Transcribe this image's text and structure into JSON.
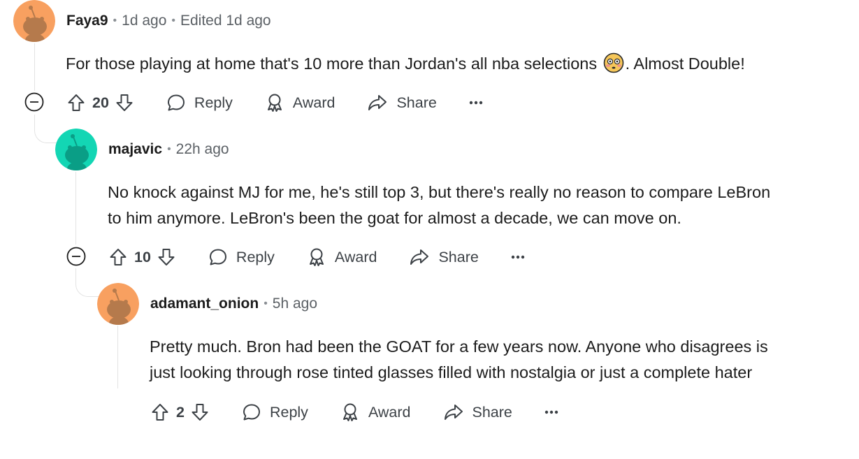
{
  "comments": [
    {
      "author": "Faya9",
      "age": "1d ago",
      "edited": "Edited 1d ago",
      "avatar_color": "#f8a060",
      "body_before_emoji": "For those playing at home that's 10 more than Jordan's all nba selections ",
      "emoji": "flushed-face",
      "body_after_emoji": ". Almost Double!",
      "votes": "20",
      "reply_label": "Reply",
      "award_label": "Award",
      "share_label": "Share"
    },
    {
      "author": "majavic",
      "age": "22h ago",
      "avatar_color": "#13d6b4",
      "body_lines": [
        "No knock against MJ for me, he's still top 3, but there's really no reason to compare LeBron",
        "to him anymore. LeBron's been the goat for almost a decade, we can move on."
      ],
      "votes": "10",
      "reply_label": "Reply",
      "award_label": "Award",
      "share_label": "Share"
    },
    {
      "author": "adamant_onion",
      "age": "5h ago",
      "avatar_color": "#f8a060",
      "body_lines": [
        "Pretty much. Bron had been the GOAT for a few years now. Anyone who disagrees is",
        "just looking through rose tinted glasses filled with nostalgia or just a complete hater"
      ],
      "votes": "2",
      "reply_label": "Reply",
      "award_label": "Award",
      "share_label": "Share"
    }
  ],
  "colors": {
    "text": "#1c1c1c",
    "meta": "#5c6166",
    "thread_line": "#e3e3e3",
    "action": "#3c4146"
  }
}
